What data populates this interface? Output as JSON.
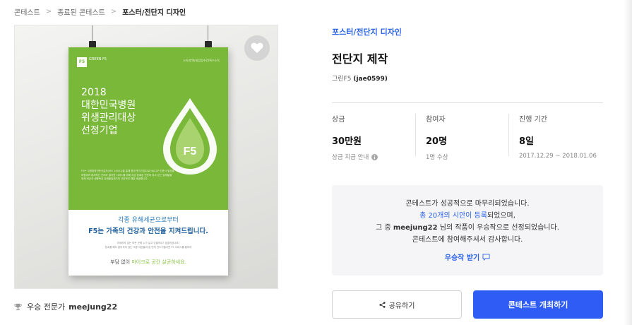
{
  "breadcrumb": {
    "items": [
      "콘테스트",
      "종료된 콘테스트",
      "포스터/전단지 디자인"
    ],
    "separator": ">"
  },
  "poster": {
    "logo": "F5",
    "logo_text": "GREEN F5",
    "tags": "소독/방역/세입입주건/특수소독",
    "headline": "2018\n대한민국병원\n위생관리대상\n선정기업",
    "drop_mark": "F5",
    "small_text": "F5는 국제환경전문사업자(ISO 14001)을 통해 환경 평가기업으로 HACCP 인증 사업장을\n체험하며 체계적인 관리와 철저한 서비스를 위해 지금 등록된 전문대 되고 있는 업체들을\n위해 세균과 생활독성 유해물질제거의 근본적인 해결 제공합니다.",
    "sub_line1": "각종 유해세균으로부터",
    "sub_line2": "F5는 가족의 건강과 안전을 지켜드립니다.",
    "fine_print": "미세하지 않는 모든 곳에 누가 살고 있을까요? 궁금하셨나요?\n청소를 해도 없어지지 않는 각종 세균들과 집 먼지 진드기들이면 F5 서비스를 통하여",
    "bottom_prefix": "부담 없이 ",
    "bottom_highlight": "마이크로 공간 살균하세요."
  },
  "like_button": {
    "icon": "heart-icon"
  },
  "winner": {
    "label": "우승 전문가",
    "name": "meejung22",
    "icon": "trophy-icon"
  },
  "contest": {
    "category": "포스터/전단지 디자인",
    "title": "전단지 제작",
    "author_name": "그린F5",
    "author_id": "(jae0599)"
  },
  "stats": [
    {
      "label": "상금",
      "value": "30만원",
      "sub": "상금 지급 안내",
      "sub_icon": "info-icon"
    },
    {
      "label": "참여자",
      "value": "20명",
      "sub": "1명 수상"
    },
    {
      "label": "진행 기간",
      "value": "8일",
      "sub": "2017.12.29 ~ 2018.01.06"
    }
  ],
  "notice": {
    "line1": "콘테스트가 성공적으로 마무리되었습니다.",
    "line2_link": "총 20개의 시안이 등록",
    "line2_rest": "되었으며,",
    "line3_prefix": "그 중 ",
    "line3_name": "meejung22",
    "line3_rest": " 님의 작품이 우승작으로 선정되었습니다.",
    "line4": "콘테스트에 참여해주셔서 감사합니다.",
    "receive_label": "우승작 받기"
  },
  "buttons": {
    "share_label": "공유하기",
    "host_label": "콘테스트 개최하기"
  },
  "colors": {
    "accent_blue": "#2a62e6",
    "primary_button": "#2f5cf5",
    "poster_green": "#7ab83a"
  }
}
